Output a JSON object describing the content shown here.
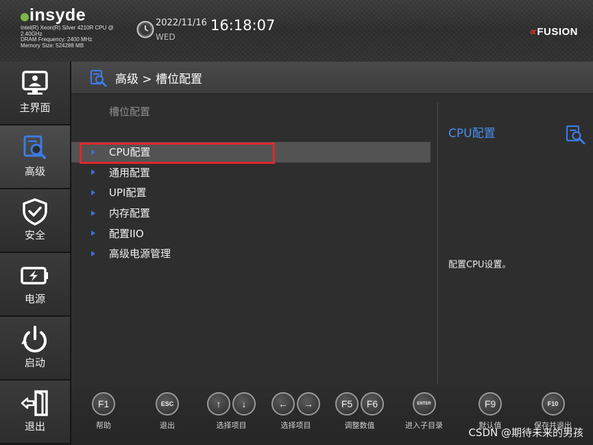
{
  "header": {
    "brand": "insyde",
    "cpu_info": [
      "Intel(R) Xeon(R) Silver 4210R CPU @",
      "2.40GHz",
      "DRAM Frequency: 2400 MHz",
      "Memory Size: 524288 MB"
    ],
    "date": "2022/11/16",
    "weekday": "WED",
    "time": "16:18:07",
    "vendor_logo_mark": "∝",
    "vendor_logo_text": "FUSION"
  },
  "sidebar": {
    "items": [
      {
        "label": "主界面",
        "icon": "monitor-icon"
      },
      {
        "label": "高级",
        "icon": "advanced-search-icon",
        "active": true
      },
      {
        "label": "安全",
        "icon": "shield-check-icon"
      },
      {
        "label": "电源",
        "icon": "battery-bolt-icon"
      },
      {
        "label": "启动",
        "icon": "power-refresh-icon"
      },
      {
        "label": "退出",
        "icon": "exit-door-icon"
      }
    ]
  },
  "main": {
    "breadcrumb": "高级 > 槽位配置",
    "section_title": "槽位配置",
    "menu_items": [
      {
        "label": "CPU配置",
        "selected": true
      },
      {
        "label": "通用配置"
      },
      {
        "label": "UPI配置"
      },
      {
        "label": "内存配置"
      },
      {
        "label": "配置IIO"
      },
      {
        "label": "高级电源管理"
      }
    ],
    "help_title": "CPU配置",
    "help_text": "配置CPU设置。"
  },
  "bottom_bar": {
    "keys": [
      {
        "keys": [
          "F1"
        ],
        "label": "帮助"
      },
      {
        "keys": [
          "ESC"
        ],
        "label": "退出"
      },
      {
        "keys": [
          "↑",
          "↓"
        ],
        "label": "选择项目"
      },
      {
        "keys": [
          "←",
          "→"
        ],
        "label": "选择项目"
      },
      {
        "keys": [
          "F5",
          "F6"
        ],
        "label": "调整数值"
      },
      {
        "keys": [
          "ENTER"
        ],
        "label": "进入子目录"
      },
      {
        "keys": [
          "F9"
        ],
        "label": "默认值"
      },
      {
        "keys": [
          "F10"
        ],
        "label": "保存并退出"
      }
    ],
    "watermark": "CSDN @期待未来的男孩"
  },
  "colors": {
    "accent_blue": "#4b8ff0",
    "arrow_blue": "#3c6fd6",
    "highlight_red": "#e0262d",
    "brand_green": "#7ab648",
    "vendor_red": "#e3342f"
  }
}
